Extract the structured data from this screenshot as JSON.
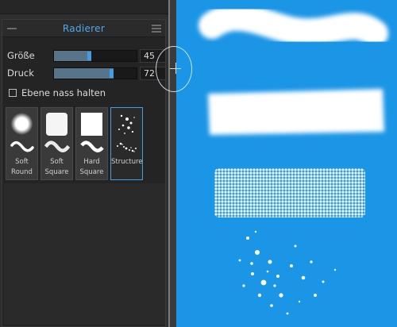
{
  "panel": {
    "title": "Radierer"
  },
  "sliders": {
    "size": {
      "label": "Größe",
      "value": "45",
      "fraction": 0.45
    },
    "pressure": {
      "label": "Druck",
      "value": "72",
      "fraction": 0.72
    }
  },
  "wet_layer": {
    "label": "Ebene nass halten",
    "checked": false
  },
  "brushes": [
    {
      "name_line1": "Soft",
      "name_line2": "Round",
      "selected": false
    },
    {
      "name_line1": "Soft",
      "name_line2": "Square",
      "selected": false
    },
    {
      "name_line1": "Hard",
      "name_line2": "Square",
      "selected": false
    },
    {
      "name_line1": "Structure",
      "name_line2": "",
      "selected": true
    }
  ],
  "colors": {
    "accent": "#3d9ee9",
    "canvas": "#1b95e6",
    "panel": "#242424"
  }
}
